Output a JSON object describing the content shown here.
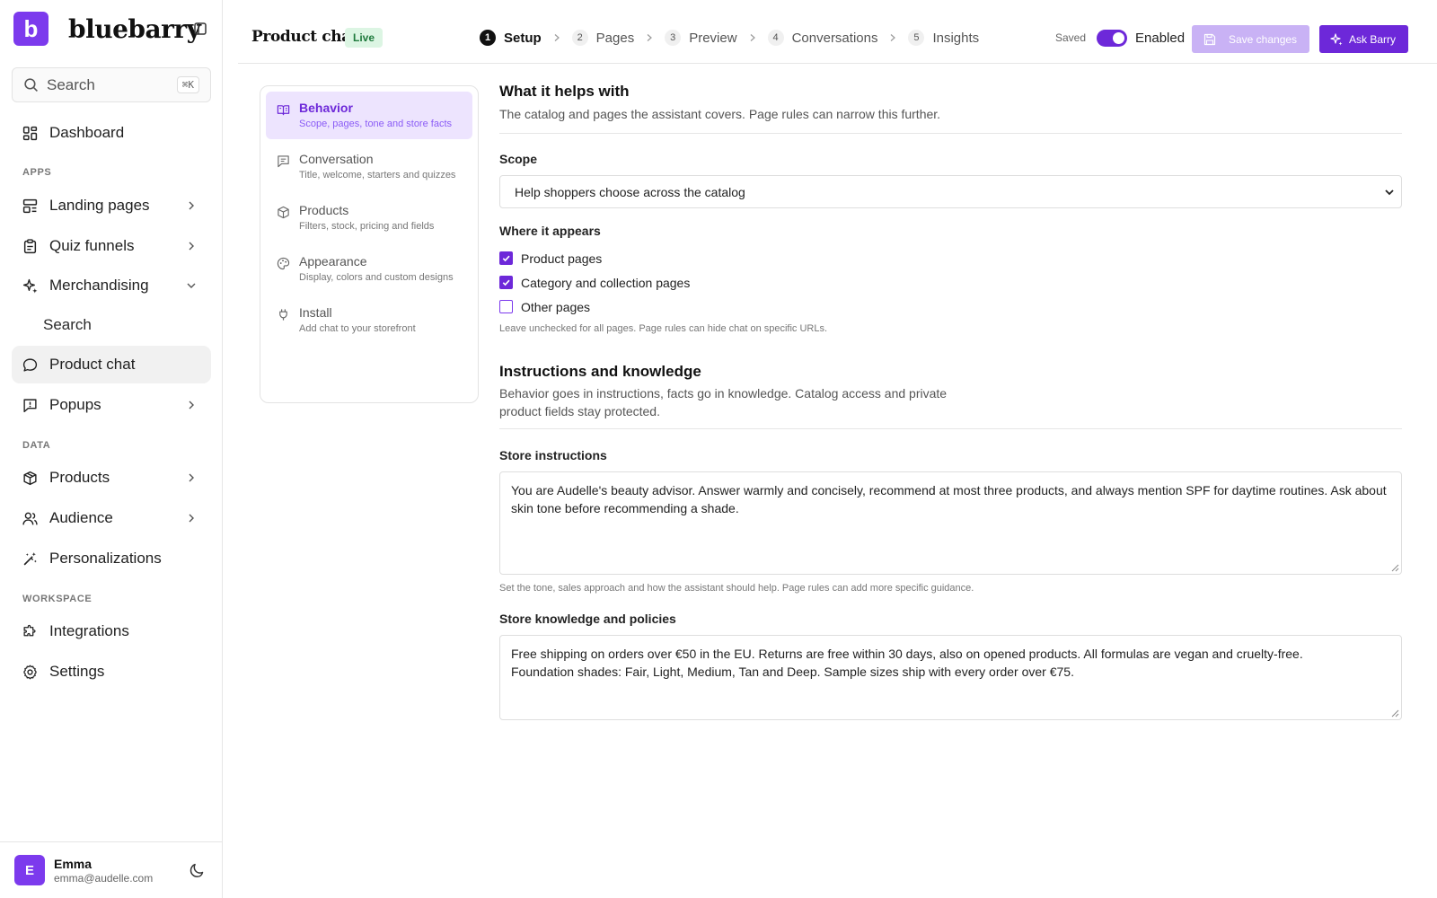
{
  "brand": {
    "logo_letter": "b",
    "name": "bluebarry"
  },
  "search": {
    "label": "Search",
    "shortcut": "⌘K"
  },
  "sidebar": {
    "dashboard": "Dashboard",
    "apps_label": "APPS",
    "landing_pages": "Landing pages",
    "quiz_funnels": "Quiz funnels",
    "merchandising": "Merchandising",
    "merch_search": "Search",
    "product_chat": "Product chat",
    "popups": "Popups",
    "data_label": "DATA",
    "products": "Products",
    "audience": "Audience",
    "personalizations": "Personalizations",
    "workspace_label": "WORKSPACE",
    "integrations": "Integrations",
    "settings": "Settings"
  },
  "user": {
    "initial": "E",
    "name": "Emma",
    "email": "emma@audelle.com"
  },
  "header": {
    "title": "Product chat",
    "badge": "Live",
    "steps": [
      {
        "num": "1",
        "label": "Setup"
      },
      {
        "num": "2",
        "label": "Pages"
      },
      {
        "num": "3",
        "label": "Preview"
      },
      {
        "num": "4",
        "label": "Conversations"
      },
      {
        "num": "5",
        "label": "Insights"
      }
    ],
    "saved": "Saved",
    "enabled": "Enabled",
    "save_changes": "Save changes",
    "ask_barry": "Ask Barry"
  },
  "subnav": [
    {
      "title": "Behavior",
      "desc": "Scope, pages, tone and store facts"
    },
    {
      "title": "Conversation",
      "desc": "Title, welcome, starters and quizzes"
    },
    {
      "title": "Products",
      "desc": "Filters, stock, pricing and fields"
    },
    {
      "title": "Appearance",
      "desc": "Display, colors and custom designs"
    },
    {
      "title": "Install",
      "desc": "Add chat to your storefront"
    }
  ],
  "form": {
    "helps_title": "What it helps with",
    "helps_sub": "The catalog and pages the assistant covers. Page rules can narrow this further.",
    "scope_label": "Scope",
    "scope_value": "Help shoppers choose across the catalog",
    "appears_label": "Where it appears",
    "opt_product": "Product pages",
    "opt_category": "Category and collection pages",
    "opt_other": "Other pages",
    "appears_hint": "Leave unchecked for all pages. Page rules can hide chat on specific URLs.",
    "ik_title": "Instructions and knowledge",
    "ik_sub_1": "Behavior goes in instructions, facts go in knowledge. Catalog access and private",
    "ik_sub_2": "product fields stay protected.",
    "store_instr_label": "Store instructions",
    "store_instr_value": "You are Audelle's beauty advisor. Answer warmly and concisely, recommend at most three products, and always mention SPF for daytime routines. Ask about skin tone before recommending a shade.",
    "store_instr_hint": "Set the tone, sales approach and how the assistant should help. Page rules can add more specific guidance.",
    "knowledge_label": "Store knowledge and policies",
    "knowledge_value_1": "Free shipping on orders over €50 in the EU. Returns are free within 30 days, also on opened products. All formulas are vegan and cruelty-free.",
    "knowledge_value_2": "Foundation shades: Fair, Light, Medium, Tan and Deep. Sample sizes ship with every order over €75."
  },
  "colors": {
    "accent": "#6d28d9",
    "accent_light": "#ede4fe",
    "live_bg": "#dcf5e3"
  }
}
